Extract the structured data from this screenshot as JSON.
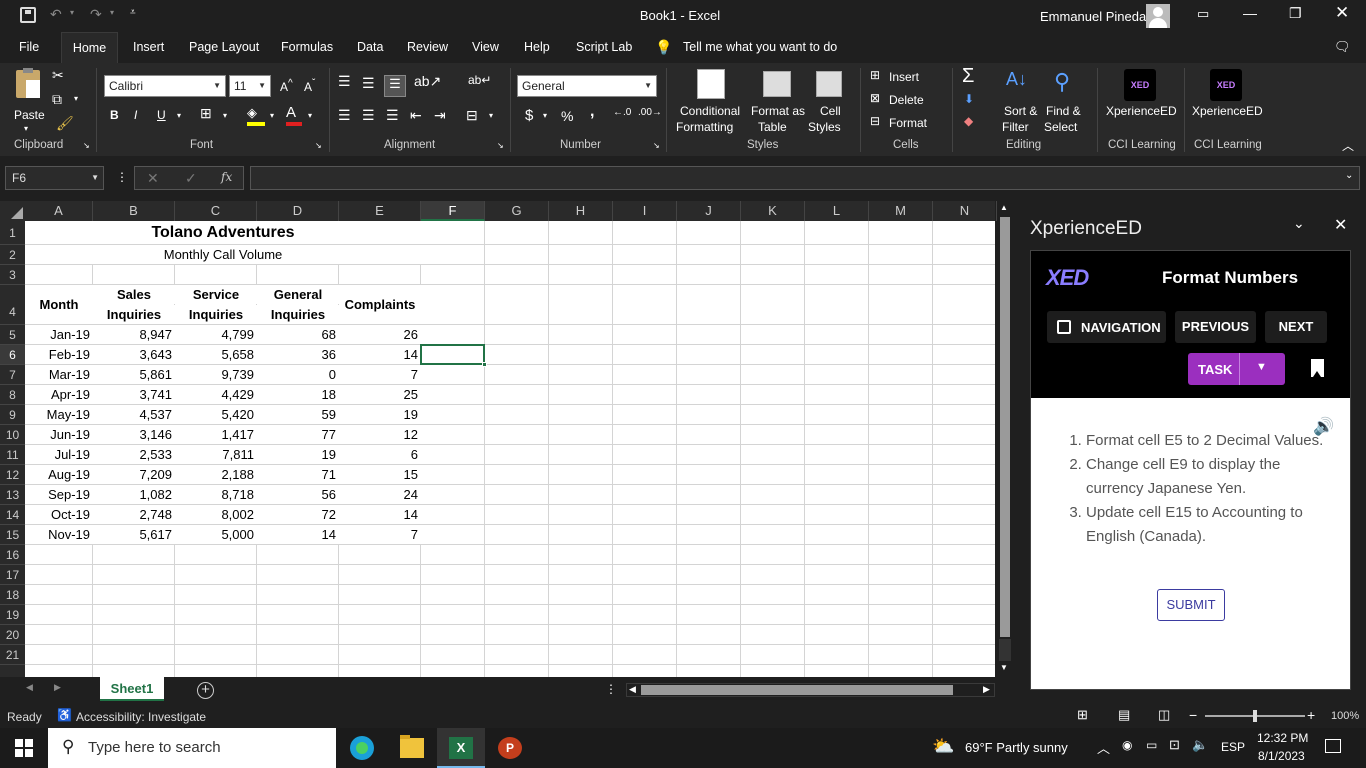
{
  "title": {
    "doc": "Book1",
    "sep": "-",
    "app": "Excel",
    "user": "Emmanuel Pineda"
  },
  "tabs": [
    "File",
    "Home",
    "Insert",
    "Page Layout",
    "Formulas",
    "Data",
    "Review",
    "View",
    "Help",
    "Script Lab"
  ],
  "tell_me": "Tell me what you want to do",
  "ribbon": {
    "paste": "Paste",
    "clipboard": "Clipboard",
    "font_name": "Calibri",
    "font_size": "11",
    "font_group": "Font",
    "alignment_group": "Alignment",
    "number_format": "General",
    "number_group": "Number",
    "currency": "$",
    "percent": "%",
    "comma": ",",
    "cond_fmt_1": "Conditional",
    "cond_fmt_2": "Formatting",
    "format_table_1": "Format as",
    "format_table_2": "Table",
    "cell_styles_1": "Cell",
    "cell_styles_2": "Styles",
    "styles_group": "Styles",
    "insert": "Insert",
    "delete": "Delete",
    "format": "Format",
    "cells_group": "Cells",
    "sort_1": "Sort &",
    "sort_2": "Filter",
    "find_1": "Find &",
    "find_2": "Select",
    "editing_group": "Editing",
    "xed_1": "XperienceED",
    "xed_2": "XperienceED",
    "cci_1": "CCI Learning",
    "cci_2": "CCI Learning"
  },
  "formula_bar": {
    "name_box": "F6",
    "fx": "fx",
    "value": ""
  },
  "columns": [
    "A",
    "B",
    "C",
    "D",
    "E",
    "F",
    "G",
    "H",
    "I",
    "J",
    "K",
    "L",
    "M",
    "N"
  ],
  "rows": [
    "1",
    "2",
    "3",
    "4",
    "5",
    "6",
    "7",
    "8",
    "9",
    "10",
    "11",
    "12",
    "13",
    "14",
    "15",
    "16",
    "17",
    "18",
    "19",
    "20",
    "21"
  ],
  "sheet": {
    "title": "Tolano Adventures",
    "subtitle": "Monthly Call Volume",
    "headers": {
      "month": "Month",
      "sales_1": "Sales",
      "sales_2": "Inquiries",
      "service_1": "Service",
      "service_2": "Inquiries",
      "general_1": "General",
      "general_2": "Inquiries",
      "complaints": "Complaints"
    },
    "data": [
      [
        "Jan-19",
        "8,947",
        "4,799",
        "68",
        "26"
      ],
      [
        "Feb-19",
        "3,643",
        "5,658",
        "36",
        "14"
      ],
      [
        "Mar-19",
        "5,861",
        "9,739",
        "0",
        "7"
      ],
      [
        "Apr-19",
        "3,741",
        "4,429",
        "18",
        "25"
      ],
      [
        "May-19",
        "4,537",
        "5,420",
        "59",
        "19"
      ],
      [
        "Jun-19",
        "3,146",
        "1,417",
        "77",
        "12"
      ],
      [
        "Jul-19",
        "2,533",
        "7,811",
        "19",
        "6"
      ],
      [
        "Aug-19",
        "7,209",
        "2,188",
        "71",
        "15"
      ],
      [
        "Sep-19",
        "1,082",
        "8,718",
        "56",
        "24"
      ],
      [
        "Oct-19",
        "2,748",
        "8,002",
        "72",
        "14"
      ],
      [
        "Nov-19",
        "5,617",
        "5,000",
        "14",
        "7"
      ]
    ]
  },
  "sheet_tab": "Sheet1",
  "status": {
    "ready": "Ready",
    "accessibility": "Accessibility: Investigate",
    "zoom": "100%"
  },
  "pane": {
    "title": "XperienceED",
    "logo": "XED",
    "heading": "Format Numbers",
    "navigation": "NAVIGATION",
    "previous": "PREVIOUS",
    "next": "NEXT",
    "task": "TASK",
    "tasks": [
      "Format cell E5 to 2 Decimal Values.",
      "Change cell E9 to display the currency Japanese Yen.",
      "Update cell E15 to Accounting to English (Canada)."
    ],
    "submit": "SUBMIT"
  },
  "taskbar": {
    "search": "Type here to search",
    "weather": "69°F  Partly sunny",
    "lang": "ESP",
    "time": "12:32 PM",
    "date": "8/1/2023"
  },
  "colors": {
    "excel_green": "#217346",
    "accent_purple": "#9b2fbf",
    "grid_bg": "#ffffff"
  }
}
